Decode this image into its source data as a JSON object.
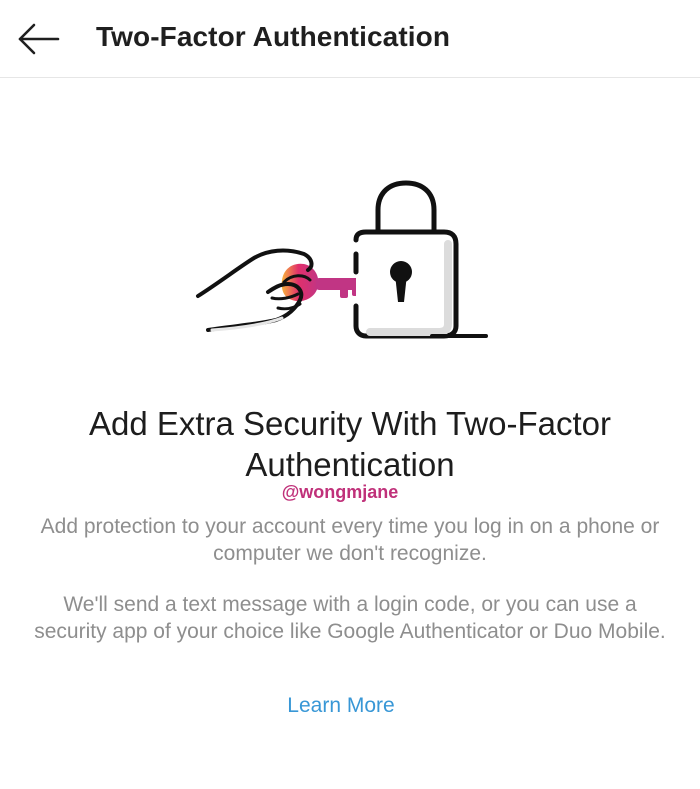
{
  "header": {
    "title": "Two-Factor Authentication",
    "back_icon": "arrow-left-icon"
  },
  "illustration": {
    "icons": [
      "hand-icon",
      "key-icon",
      "padlock-icon"
    ],
    "key_gradient": [
      "#f7b23b",
      "#e1306c",
      "#c13584"
    ]
  },
  "content": {
    "headline": "Add Extra Security With Two-Factor Authentication",
    "watermark": "@wongmjane",
    "paragraph_1": "Add protection to your account every time you log in on a phone or computer we don't recognize.",
    "paragraph_2": "We'll send a text message with a login code, or you can use a security app of your choice like Google Authenticator or Duo Mobile.",
    "learn_more": "Learn More"
  },
  "colors": {
    "link": "#3897d6",
    "body_text": "#8e8e8e",
    "headline": "#1d1d1d",
    "watermark": "#c0317a"
  }
}
